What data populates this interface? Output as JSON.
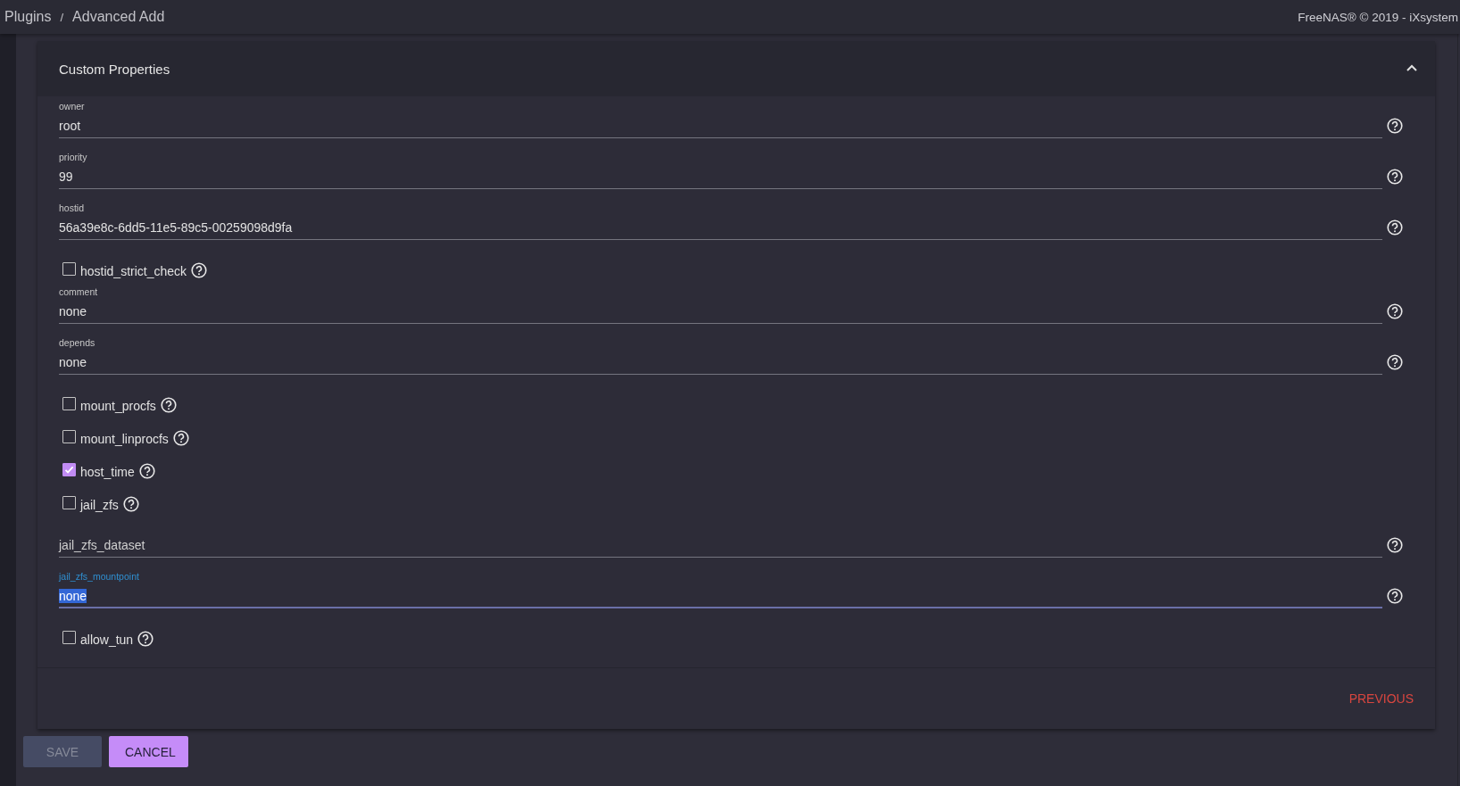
{
  "breadcrumb": [
    "Plugins",
    "Advanced Add"
  ],
  "breadcrumb_separator": "/",
  "copyright": "FreeNAS® © 2019 - iXsystem",
  "card": {
    "title": "Custom Properties",
    "expanded": true
  },
  "properties": [
    {
      "kind": "field",
      "label": "owner",
      "value": "root",
      "focused": false
    },
    {
      "kind": "field",
      "label": "priority",
      "value": "99",
      "focused": false
    },
    {
      "kind": "field",
      "label": "hostid",
      "value": "56a39e8c-6dd5-11e5-89c5-00259098d9fa",
      "focused": false
    },
    {
      "kind": "checkbox",
      "label": "hostid_strict_check",
      "checked": false
    },
    {
      "kind": "field",
      "label": "comment",
      "value": "none",
      "focused": false
    },
    {
      "kind": "field",
      "label": "depends",
      "value": "none",
      "focused": false
    },
    {
      "kind": "checkbox",
      "label": "mount_procfs",
      "checked": false
    },
    {
      "kind": "checkbox",
      "label": "mount_linprocfs",
      "checked": false
    },
    {
      "kind": "checkbox",
      "label": "host_time",
      "checked": true
    },
    {
      "kind": "checkbox",
      "label": "jail_zfs",
      "checked": false
    },
    {
      "kind": "field",
      "placeholder": "jail_zfs_dataset",
      "focused": false
    },
    {
      "kind": "field",
      "label": "jail_zfs_mountpoint",
      "value": "none",
      "focused": true
    },
    {
      "kind": "checkbox",
      "label": "allow_tun",
      "checked": false
    }
  ],
  "previous_button": "PREVIOUS",
  "buttons": [
    {
      "label": "SAVE",
      "disabled": true
    },
    {
      "label": "CANCEL",
      "disabled": false
    }
  ]
}
